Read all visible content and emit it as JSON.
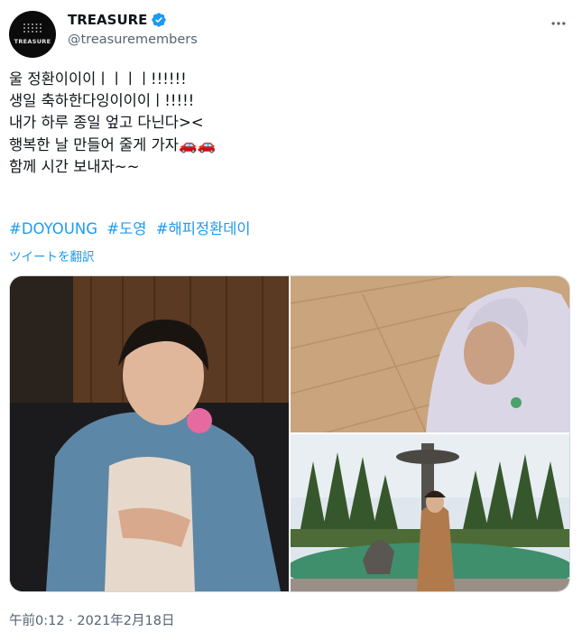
{
  "user": {
    "display_name": "TREASURE",
    "handle": "@treasuremembers",
    "avatar_logo_text": "TREASURE",
    "verified": true
  },
  "tweet": {
    "lines": [
      "울 정환이이이ㅣㅣㅣㅣ!!!!!!",
      "생일 축하한다잉이이이ㅣ!!!!!",
      "내가 하루 종일 엎고 다닌다><",
      "행복한 날 만들어 줄게 가자🚗🚗",
      "함께 시간 보내자~~"
    ],
    "hashtags": [
      "#DOYOUNG",
      "#도영",
      "#해피정환데이"
    ],
    "translate_label": "ツイートを翻訳",
    "timestamp": "午前0:12 · 2021年2月18日"
  },
  "media": {
    "photos": [
      {
        "description": "photo-sleeping-in-blue-puffer-jacket"
      },
      {
        "description": "photo-lying-on-floor-in-hoodie"
      },
      {
        "description": "photo-garden-fountain-in-brown-coat"
      }
    ]
  },
  "colors": {
    "link": "#1d9bf0",
    "secondary_text": "#536471",
    "verified": "#1d9bf0",
    "border": "#cfd9de"
  },
  "icons": {
    "verified": "verified-badge-icon",
    "more": "more-horizontal-icon"
  }
}
